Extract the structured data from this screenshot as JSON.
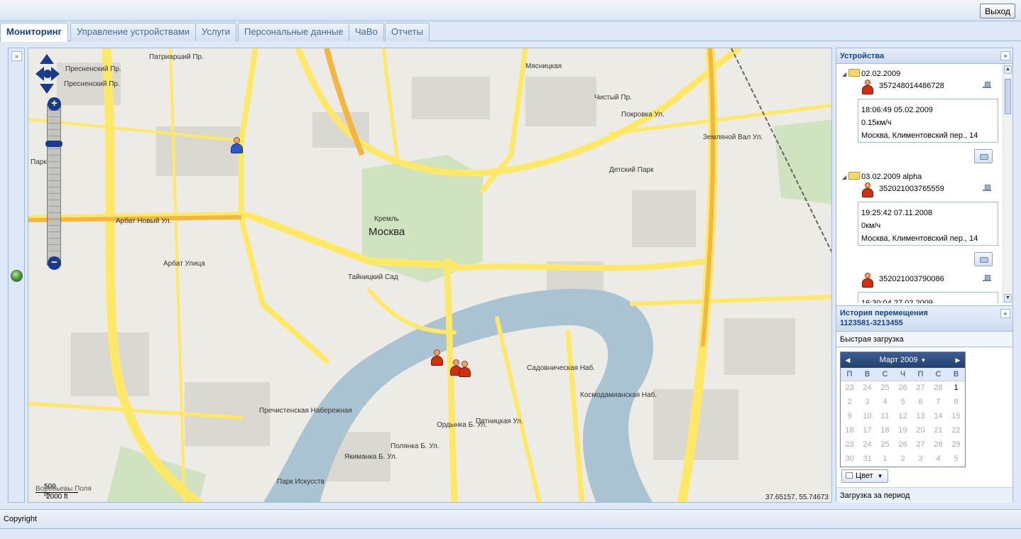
{
  "header": {
    "exit_label": "Выход"
  },
  "tabs": [
    {
      "label": "Мониторинг",
      "active": true
    },
    {
      "label": "Управление устройствами",
      "active": false
    },
    {
      "label": "Услуги",
      "active": false
    },
    {
      "label": "Персональные данные",
      "active": false
    },
    {
      "label": "ЧаВо",
      "active": false
    },
    {
      "label": "Отчеты",
      "active": false
    }
  ],
  "left_strip": {
    "expand_icon": "double-chevron-right-icon"
  },
  "map": {
    "city_label": "Москва",
    "labels": [
      "Пресненский Пр.",
      "Пресненский Пр.",
      "Патриарший Пр.",
      "Чистый Пр.",
      "Покровка Ул.",
      "Детский Парк",
      "Кремль",
      "Арбат Новый Ул.",
      "Арбат Улица",
      "Тайницкий Сад",
      "Пречистенская Набережная",
      "Садовническая Наб.",
      "Космодамианская Наб.",
      "Пятницкая Ул.",
      "Ордынка Б. Ул.",
      "Полянка Б. Ул.",
      "Якиманка Б. Ул.",
      "Парк Искусств",
      "Земляной Вал Ул.",
      "Парк",
      "Мясницкая"
    ],
    "coordinates": "37.65157, 55.74673",
    "scale_top": "500 m",
    "scale_bottom": "2000 ft",
    "scale_overlap": "Воробьевы Поля"
  },
  "devices_panel": {
    "title": "Устройства",
    "groups": [
      {
        "name": "02.02.2009",
        "devices": [
          {
            "id": "357248014486728",
            "time": "18:06:49 05.02.2009",
            "speed": "0.15км/ч",
            "address": "Москва, Климентовский пер., 14"
          }
        ]
      },
      {
        "name": "03.02.2009 alpha",
        "devices": [
          {
            "id": "352021003765559",
            "time": "19:25:42 07.11.2008",
            "speed": "0км/ч",
            "address": "Москва, Климентовский пер., 14"
          },
          {
            "id": "352021003790086",
            "time": "16:30:04 27.02.2009",
            "speed": "",
            "address": ""
          }
        ]
      }
    ]
  },
  "history_panel": {
    "title": "История перемещения",
    "phone": "1123581-3213455",
    "quick_load": "Быстрая загрузка",
    "calendar": {
      "month_label": "Март 2009",
      "weekdays": [
        "П",
        "В",
        "С",
        "Ч",
        "П",
        "С",
        "В"
      ],
      "weeks": [
        [
          {
            "d": "23",
            "cur": false
          },
          {
            "d": "24",
            "cur": false
          },
          {
            "d": "25",
            "cur": false
          },
          {
            "d": "26",
            "cur": false
          },
          {
            "d": "27",
            "cur": false
          },
          {
            "d": "28",
            "cur": false
          },
          {
            "d": "1",
            "cur": true
          }
        ],
        [
          {
            "d": "2",
            "cur": false
          },
          {
            "d": "3",
            "cur": false
          },
          {
            "d": "4",
            "cur": false
          },
          {
            "d": "5",
            "cur": false
          },
          {
            "d": "6",
            "cur": false
          },
          {
            "d": "7",
            "cur": false
          },
          {
            "d": "8",
            "cur": false
          }
        ],
        [
          {
            "d": "9",
            "cur": false
          },
          {
            "d": "10",
            "cur": false
          },
          {
            "d": "11",
            "cur": false
          },
          {
            "d": "12",
            "cur": false
          },
          {
            "d": "13",
            "cur": false
          },
          {
            "d": "14",
            "cur": false
          },
          {
            "d": "15",
            "cur": false
          }
        ],
        [
          {
            "d": "16",
            "cur": false
          },
          {
            "d": "17",
            "cur": false
          },
          {
            "d": "18",
            "cur": false
          },
          {
            "d": "19",
            "cur": false
          },
          {
            "d": "20",
            "cur": false
          },
          {
            "d": "21",
            "cur": false
          },
          {
            "d": "22",
            "cur": false
          }
        ],
        [
          {
            "d": "23",
            "cur": false
          },
          {
            "d": "24",
            "cur": false
          },
          {
            "d": "25",
            "cur": false
          },
          {
            "d": "26",
            "cur": false
          },
          {
            "d": "27",
            "cur": false
          },
          {
            "d": "28",
            "cur": false
          },
          {
            "d": "29",
            "cur": false
          }
        ],
        [
          {
            "d": "30",
            "cur": false
          },
          {
            "d": "31",
            "cur": false
          },
          {
            "d": "1",
            "cur": false
          },
          {
            "d": "2",
            "cur": false
          },
          {
            "d": "3",
            "cur": false
          },
          {
            "d": "4",
            "cur": false
          },
          {
            "d": "5",
            "cur": false
          }
        ]
      ]
    },
    "color_label": "Цвет",
    "period_load": "Загрузка за период"
  },
  "footer": {
    "copyright": "Copyright"
  },
  "colors": {
    "accent": "#15428b",
    "border": "#99bbe8",
    "road": "#ffee66",
    "river": "#9fb9c9",
    "park": "#cfe3c0"
  }
}
